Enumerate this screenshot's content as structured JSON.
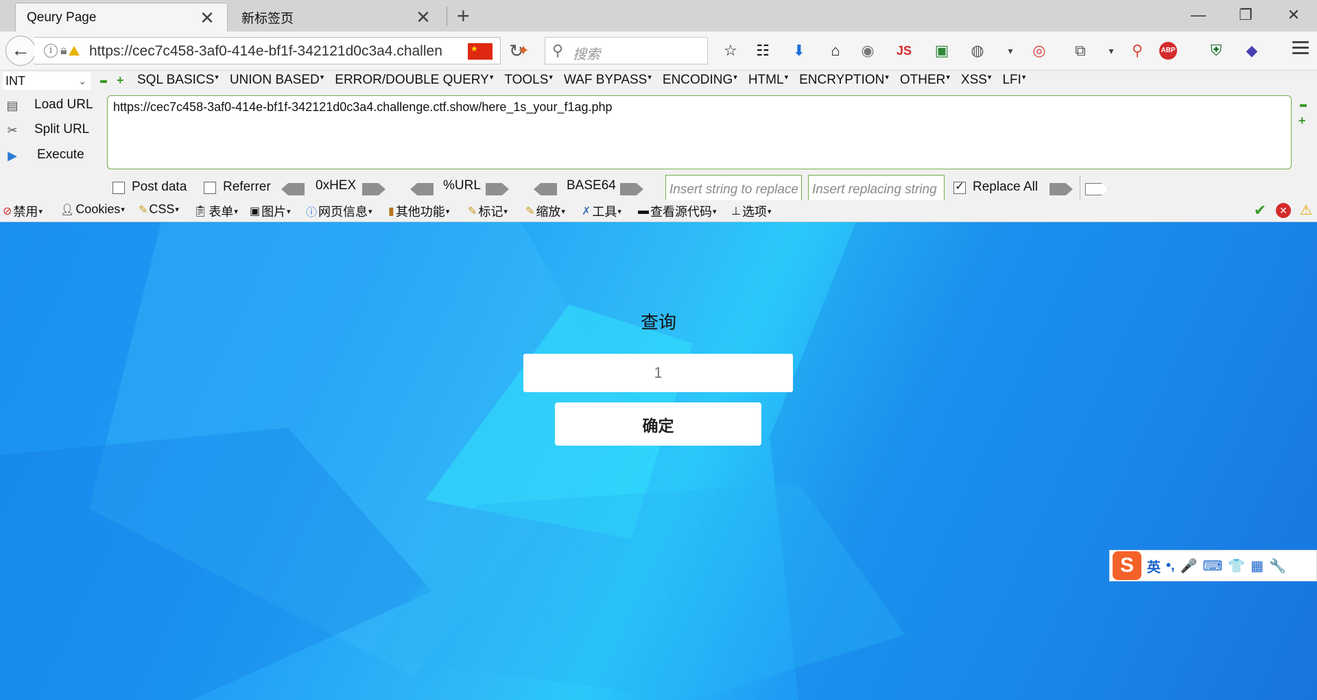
{
  "tabs": [
    {
      "title": "Qeury Page",
      "close": "✕"
    },
    {
      "title": "新标签页",
      "close": "✕"
    }
  ],
  "new_tab": "+",
  "window_controls": {
    "minimize": "—",
    "restore": "❐",
    "close": "✕"
  },
  "nav": {
    "url": "https://cec7c458-3af0-414e-bf1f-342121d0c3a4.challenge.ctf.show/here_1s_your_f1ag.php",
    "search_placeholder": "搜索",
    "js_badge": "JS",
    "abp_badge": "ABP"
  },
  "hackbar": {
    "type_select": "INT",
    "menus": [
      "SQL BASICS",
      "UNION BASED",
      "ERROR/DOUBLE QUERY",
      "TOOLS",
      "WAF BYPASS",
      "ENCODING",
      "HTML",
      "ENCRYPTION",
      "OTHER",
      "XSS",
      "LFI"
    ],
    "load_url": "Load URL",
    "split_url": "Split URL",
    "execute": "Execute",
    "url_value": "https://cec7c458-3af0-414e-bf1f-342121d0c3a4.challenge.ctf.show/here_1s_your_f1ag.php",
    "post_data": "Post data",
    "post_data_checked": false,
    "referrer": "Referrer",
    "referrer_checked": false,
    "encodings": [
      "0xHEX",
      "%URL",
      "BASE64"
    ],
    "replace_placeholder": "Insert string to replace",
    "replacing_placeholder": "Insert replacing string",
    "replace_all": "Replace All",
    "replace_all_checked": true
  },
  "webdev": {
    "items": [
      "禁用",
      "Cookies",
      "CSS",
      "表单",
      "图片",
      "网页信息",
      "其他功能",
      "标记",
      "缩放",
      "工具",
      "查看源代码",
      "选项"
    ]
  },
  "page": {
    "title": "查询",
    "input_placeholder": "1",
    "submit_label": "确定"
  },
  "ime": {
    "logo": "S",
    "lang": "英",
    "punct": "•,",
    "mic": "🎤",
    "keyboard": "⌨",
    "shirt": "👕",
    "grid": "▦",
    "tool": "🔧"
  },
  "colors": {
    "page_bg": "#1e9cf4",
    "hackbar_border": "#6fae4a",
    "accent_green": "#3c9a2a"
  }
}
